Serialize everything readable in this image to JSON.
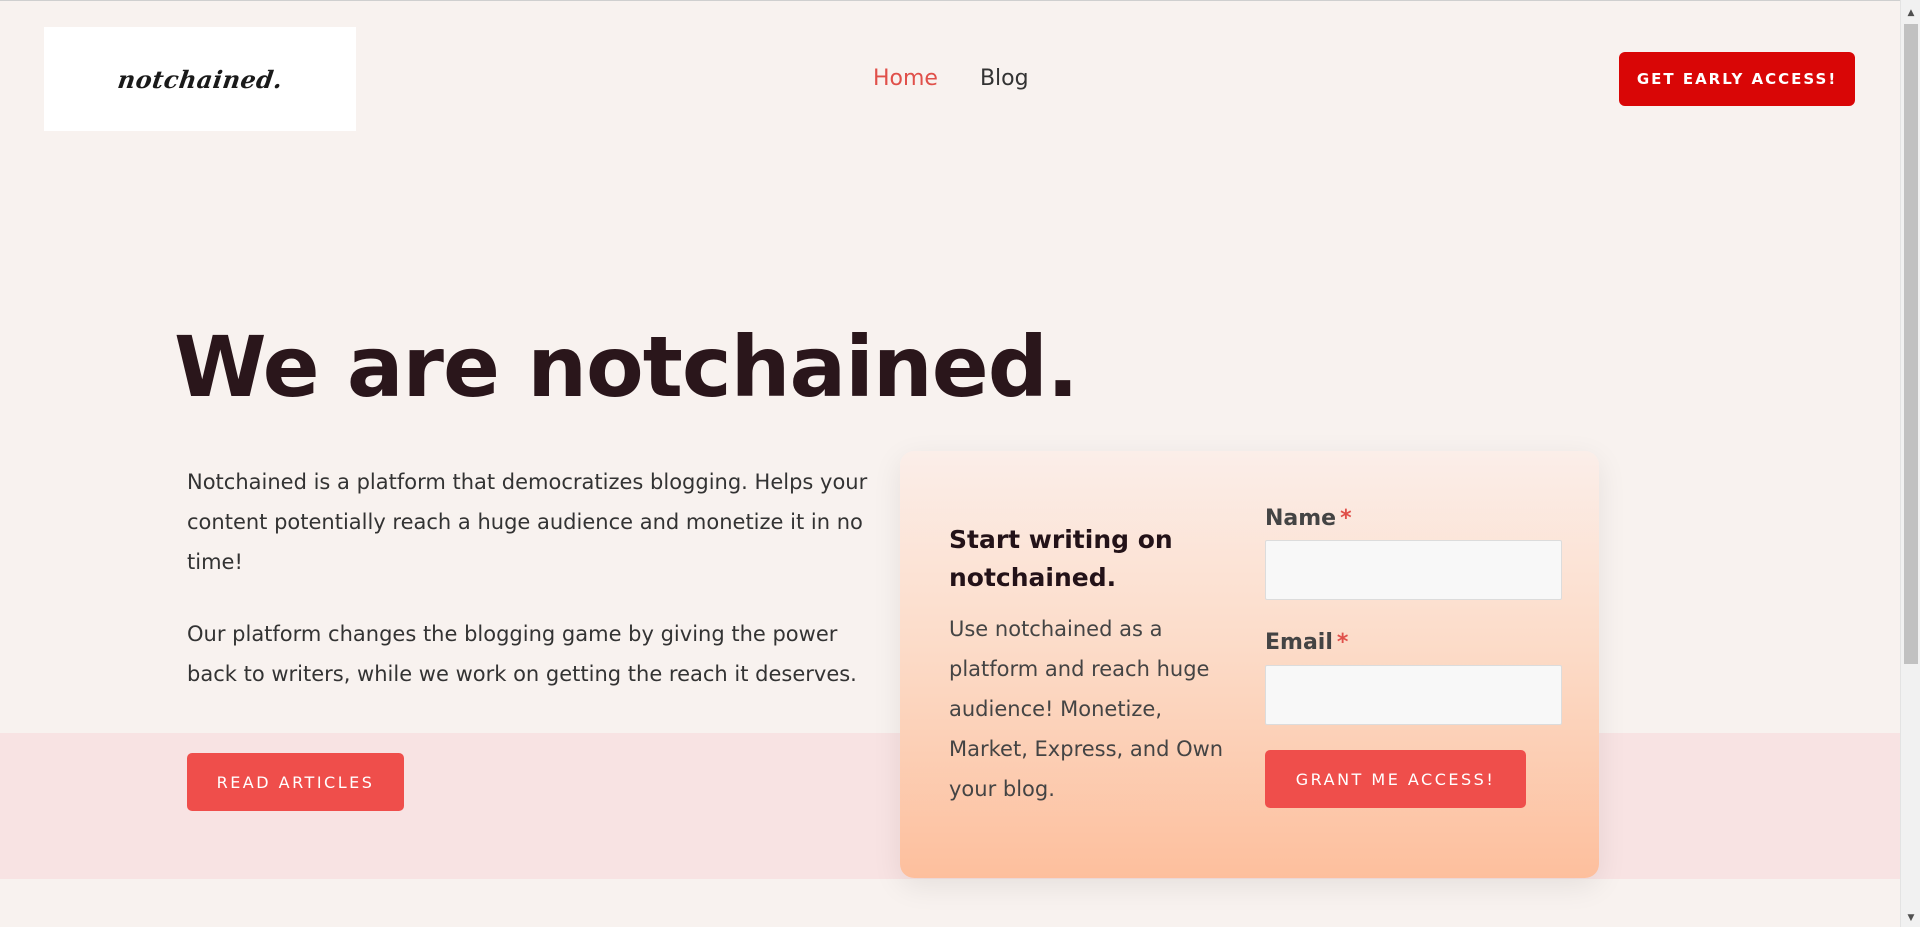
{
  "header": {
    "logo_text": "notchained.",
    "nav": [
      {
        "label": "Home",
        "active": true
      },
      {
        "label": "Blog",
        "active": false
      }
    ],
    "cta_label": "GET EARLY ACCESS!"
  },
  "hero": {
    "title": "We are notchained.",
    "paragraph_1": "Notchained is a platform that democratizes blogging. Helps your content potentially reach a huge audience and monetize it in no time!",
    "paragraph_2": "Our platform changes the blogging game by giving the power back to writers, while we work on getting the reach it deserves.",
    "read_button": "READ ARTICLES"
  },
  "signup": {
    "title": "Start writing on notchained.",
    "description": "Use notchained as a platform and reach huge audience! Monetize, Market, Express, and Own your blog.",
    "name_label": "Name",
    "email_label": "Email",
    "required_marker": "*",
    "name_value": "",
    "email_value": "",
    "submit_label": "GRANT ME ACCESS!"
  },
  "colors": {
    "accent": "#ef4e4b",
    "cta_red": "#d90606",
    "nav_active": "#e0504a",
    "title": "#2a161b",
    "page_bg": "#f8f2ef",
    "band_bg": "#f8e3e3"
  },
  "scrollbar": {
    "up_icon": "triangle-up-icon",
    "down_icon": "triangle-down-icon"
  }
}
